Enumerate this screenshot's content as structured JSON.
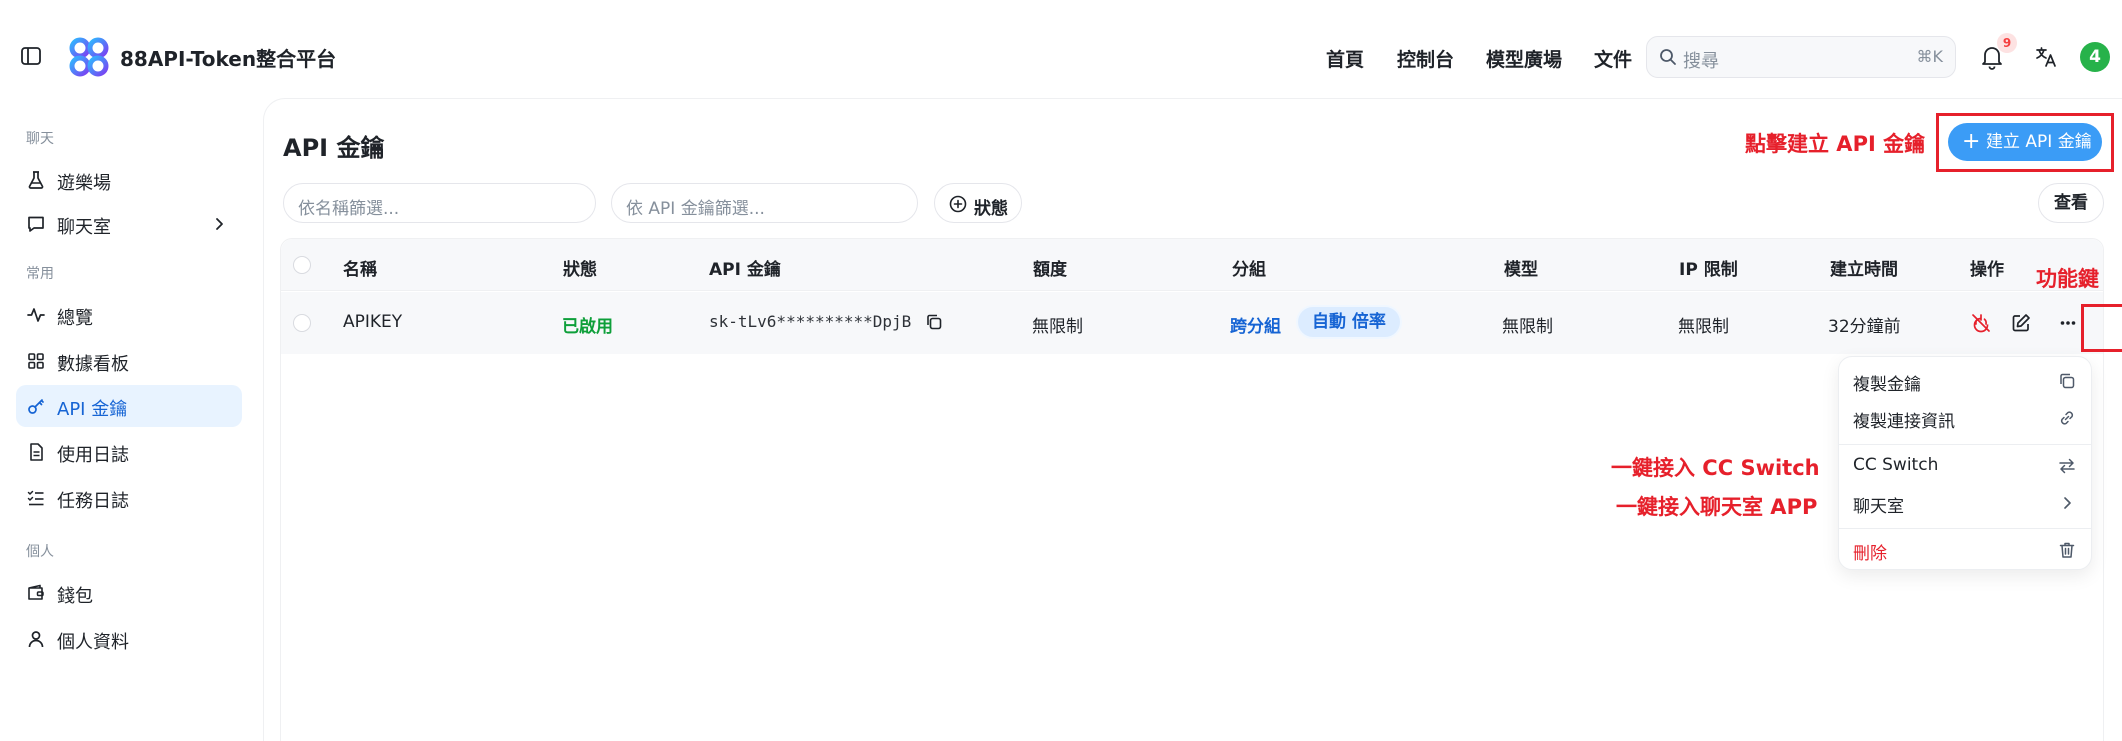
{
  "app": {
    "title": "88API-Token整合平台"
  },
  "nav": {
    "home": "首頁",
    "console": "控制台",
    "models": "模型廣場",
    "docs": "文件"
  },
  "search": {
    "placeholder": "搜尋",
    "shortcut": "⌘K"
  },
  "notifications": {
    "count": "9"
  },
  "user": {
    "avatar_text": "4",
    "avatar_color": "#27b24a"
  },
  "sidebar": {
    "groups": {
      "chat": "聊天",
      "common": "常用",
      "personal": "個人"
    },
    "items": {
      "playground": "遊樂場",
      "chatroom": "聊天室",
      "overview": "總覽",
      "dashboard": "數據看板",
      "api_keys": "API 金鑰",
      "usage_log": "使用日誌",
      "task_log": "任務日誌",
      "wallet": "錢包",
      "profile": "個人資料"
    }
  },
  "main": {
    "title": "API 金鑰",
    "filter_name_placeholder": "依名稱篩選...",
    "filter_key_placeholder": "依 API 金鑰篩選...",
    "status_filter": "狀態",
    "view_button": "查看",
    "create_button": "建立 API 金鑰"
  },
  "table": {
    "columns": [
      "名稱",
      "狀態",
      "API 金鑰",
      "額度",
      "分組",
      "模型",
      "IP 限制",
      "建立時間",
      "操作"
    ],
    "rows": [
      {
        "name": "APIKEY",
        "status": "已啟用",
        "key": "sk-tLv6**********DpjB",
        "quota": "無限制",
        "group": "跨分組",
        "group_tag": "自動 倍率",
        "model": "無限制",
        "ip_limit": "無限制",
        "created": "32分鐘前"
      }
    ]
  },
  "menu": {
    "copy_key": "複製金鑰",
    "copy_connection": "複製連接資訊",
    "cc_switch": "CC Switch",
    "chatroom": "聊天室",
    "delete": "刪除"
  },
  "annotations": {
    "create_hint": "點擊建立 API 金鑰",
    "function_key": "功能鍵",
    "cc_switch_hint": "一鍵接入 CC Switch",
    "chatroom_hint": "一鍵接入聊天室 APP"
  },
  "colors": {
    "accent": "#3b9cf6",
    "active_bg": "#e8f3ff",
    "enabled": "#0e9f3a",
    "annotation": "#e6202b"
  }
}
